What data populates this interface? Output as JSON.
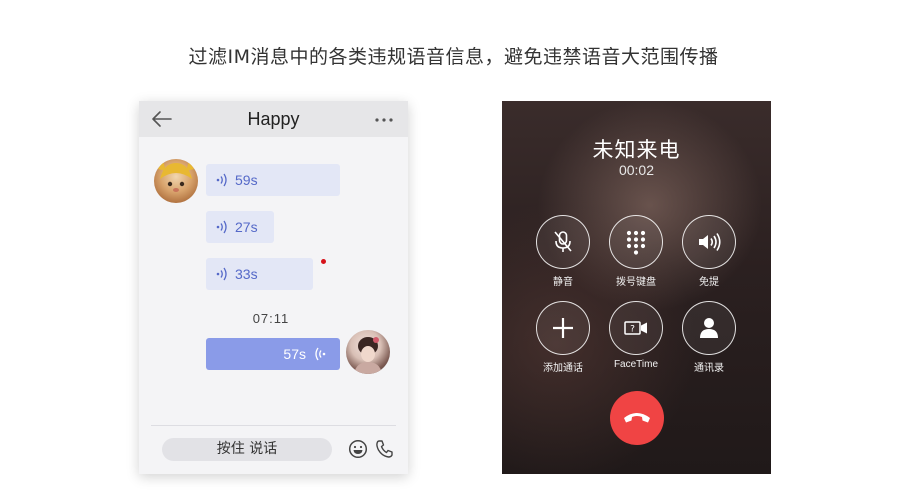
{
  "headline": "过滤IM消息中的各类违规语音信息，避免违禁语音大范围传播",
  "chat": {
    "title": "Happy",
    "messages": [
      {
        "side": "left",
        "duration": "59s"
      },
      {
        "side": "left",
        "duration": "27s"
      },
      {
        "side": "left",
        "duration": "33s",
        "unread": true
      },
      {
        "side": "right",
        "duration": "57s"
      }
    ],
    "timestamp": "07:11",
    "hold_to_talk": "按住 说话",
    "colors": {
      "incoming_bubble": "#e3e7f6",
      "outgoing_bubble": "#8a9be8",
      "unread_dot": "#d6121a"
    }
  },
  "call": {
    "caller": "未知来电",
    "timer": "00:02",
    "buttons": [
      {
        "label": "静音",
        "icon": "mic-off-icon"
      },
      {
        "label": "拨号键盘",
        "icon": "keypad-icon"
      },
      {
        "label": "免提",
        "icon": "speaker-icon"
      },
      {
        "label": "添加通话",
        "icon": "plus-icon"
      },
      {
        "label": "FaceTime",
        "icon": "facetime-icon"
      },
      {
        "label": "通讯录",
        "icon": "contact-icon"
      }
    ],
    "end_color": "#f04444"
  }
}
